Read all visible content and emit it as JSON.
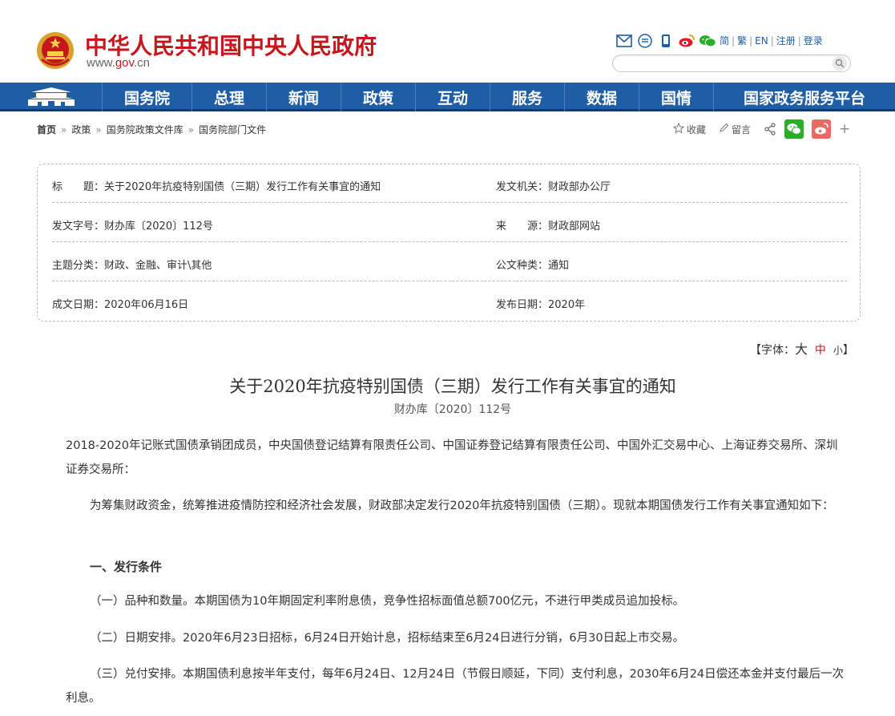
{
  "header": {
    "site_title": "中华人民共和国中央人民政府",
    "site_url_prefix": "www.",
    "site_url_gov": "gov",
    "site_url_suffix": ".cn",
    "lang_links": [
      "简",
      "繁",
      "EN",
      "注册",
      "登录"
    ],
    "search": {
      "placeholder": ""
    }
  },
  "nav": {
    "items": [
      "国务院",
      "总理",
      "新闻",
      "政策",
      "互动",
      "服务",
      "数据",
      "国情",
      "国家政务服务平台"
    ]
  },
  "breadcrumb": {
    "items": [
      "首页",
      "政策",
      "国务院政策文件库",
      "国务院部门文件"
    ],
    "separator": "»"
  },
  "share": {
    "favorite": "收藏",
    "comment": "留言",
    "plus": "+"
  },
  "meta": {
    "title_label": "标　　题：",
    "title_value": "关于2020年抗疫特别国债（三期）发行工作有关事宜的通知",
    "issuer_label": "发文机关：",
    "issuer_value": "财政部办公厅",
    "docno_label": "发文字号：",
    "docno_value": "财办库〔2020〕112号",
    "source_label": "来　　源：",
    "source_value": "财政部网站",
    "topic_label": "主题分类：",
    "topic_value": "财政、金融、审计\\其他",
    "type_label": "公文种类：",
    "type_value": "通知",
    "date_label": "成文日期：",
    "date_value": "2020年06月16日",
    "pubdate_label": "发布日期：",
    "pubdate_value": "2020年"
  },
  "fontsize": {
    "prefix": "【字体：",
    "big": "大",
    "mid": "中",
    "small": "小",
    "suffix": "】"
  },
  "article": {
    "title": "关于2020年抗疫特别国债（三期）发行工作有关事宜的通知",
    "doc_no": "财办库〔2020〕112号",
    "addressee": "2018-2020年记账式国债承销团成员，中央国债登记结算有限责任公司、中国证券登记结算有限责任公司、中国外汇交易中心、上海证券交易所、深圳证券交易所：",
    "intro": "为筹集财政资金，统筹推进疫情防控和经济社会发展，财政部决定发行2020年抗疫特别国债（三期）。现就本期国债发行工作有关事宜通知如下：",
    "section1": "一、发行条件",
    "item1": "（一）品种和数量。本期国债为10年期固定利率附息债，竞争性招标面值总额700亿元，不进行甲类成员追加投标。",
    "item2": "（二）日期安排。2020年6月23日招标，6月24日开始计息，招标结束至6月24日进行分销，6月30日起上市交易。",
    "item3": "（三）兑付安排。本期国债利息按半年支付，每年6月24日、12月24日（节假日顺延，下同）支付利息，2030年6月24日偿还本金并支付最后一次利息。"
  },
  "colors": {
    "brand_red": "#c8161d",
    "nav_blue": "#1f5ea5"
  }
}
